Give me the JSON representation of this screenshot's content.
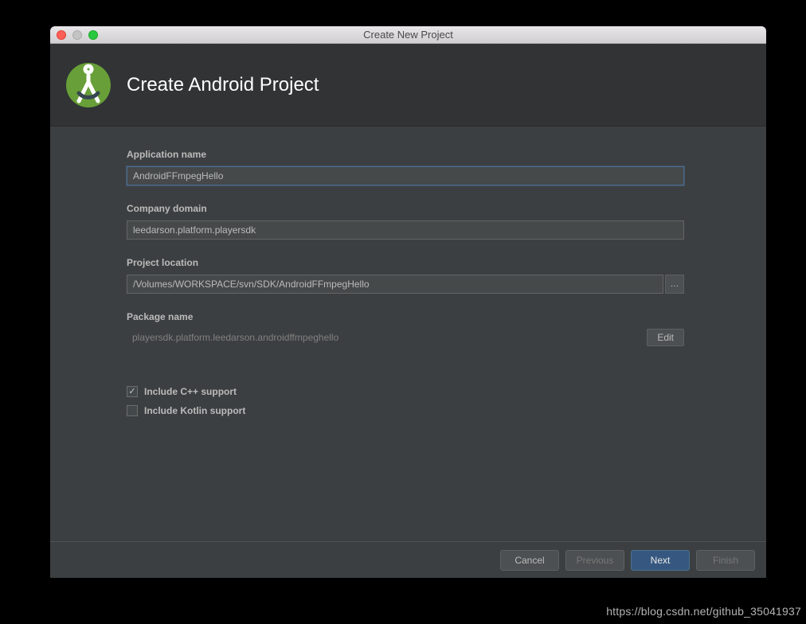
{
  "window": {
    "title": "Create New Project"
  },
  "header": {
    "title": "Create Android Project"
  },
  "fields": {
    "appName": {
      "label": "Application name",
      "value": "AndroidFFmpegHello"
    },
    "companyDomain": {
      "label": "Company domain",
      "value": "leedarson.platform.playersdk"
    },
    "projectLocation": {
      "label": "Project location",
      "value": "/Volumes/WORKSPACE/svn/SDK/AndroidFFmpegHello",
      "browseLabel": "…"
    },
    "packageName": {
      "label": "Package name",
      "value": "playersdk.platform.leedarson.androidffmpeghello",
      "editLabel": "Edit"
    }
  },
  "options": {
    "cpp": {
      "label": "Include C++ support",
      "checked": true
    },
    "kotlin": {
      "label": "Include Kotlin support",
      "checked": false
    }
  },
  "footer": {
    "cancel": "Cancel",
    "previous": "Previous",
    "next": "Next",
    "finish": "Finish"
  },
  "watermark": "https://blog.csdn.net/github_35041937"
}
